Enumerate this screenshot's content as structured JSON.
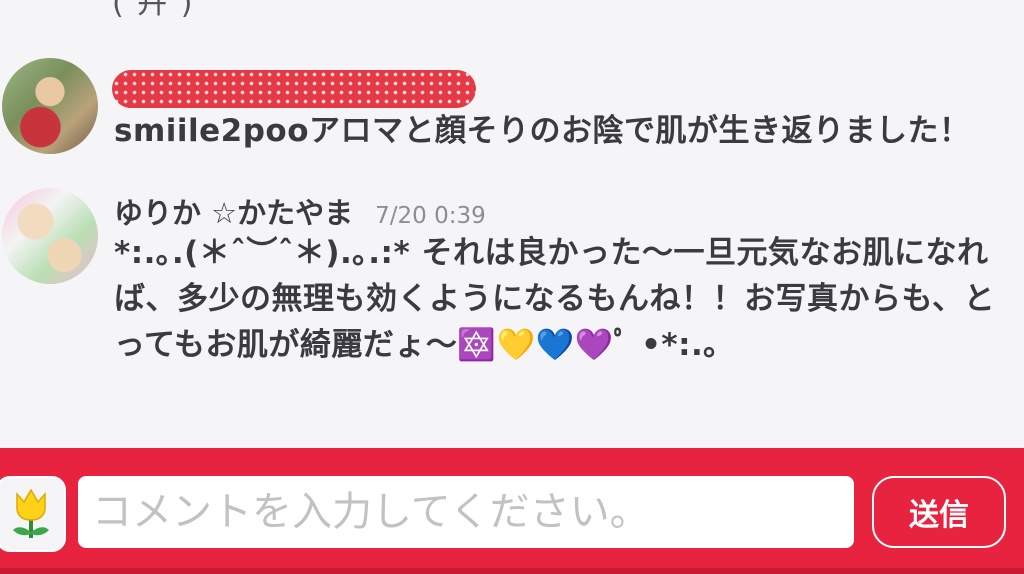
{
  "colors": {
    "accent": "#e8233f",
    "background": "#f5f5f7",
    "text": "#3a3a40",
    "timestamp": "#8d8d93",
    "placeholder": "#c2c2c6"
  },
  "top_fragment": "(  卉  )",
  "comments": [
    {
      "author_name_redacted": true,
      "text": "smiile2pooアロマと顔そりのお陰で肌が生き返りました！"
    },
    {
      "author_name": "ゆりか ☆かたやま",
      "timestamp": "7/20 0:39",
      "text": "*:.｡.(＊ˆ︶ˆ＊).｡.:* それは良かった〜一旦元気なお肌になれば、多少の無理も効くようになるもんね！！お写真からも、とってもお肌が綺麗だょ〜🔯💛💙💜ﾟ •*:.｡"
    }
  ],
  "comment_bar": {
    "stamp_icon": "tulip-icon",
    "input_placeholder": "コメントを入力してください。",
    "input_value": "",
    "send_label": "送信"
  }
}
